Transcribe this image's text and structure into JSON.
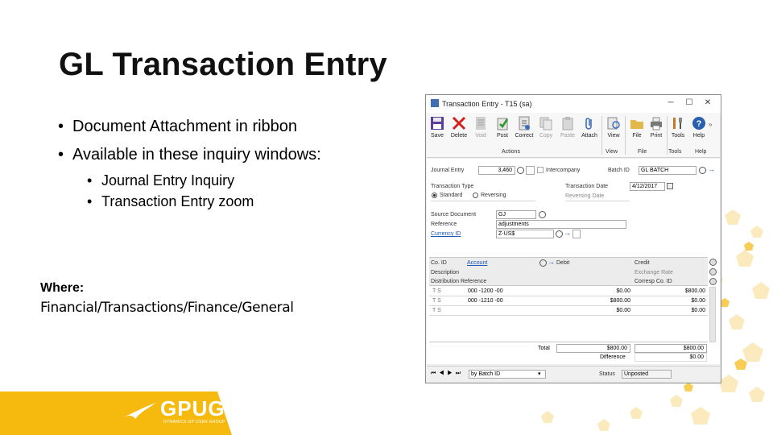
{
  "slide": {
    "title": "GL Transaction Entry",
    "bullets": [
      "Document Attachment in ribbon",
      "Available in these inquiry windows:"
    ],
    "sub_bullets": [
      "Journal Entry Inquiry",
      "Transaction Entry zoom"
    ],
    "where_label": "Where:",
    "where_path": "Financial/Transactions/Finance/General"
  },
  "logo": {
    "text": "GPUG",
    "tagline": "DYNAMICS GP USER GROUP",
    "color": "#f6b90e"
  },
  "window": {
    "title": "Transaction Entry - T15 (sa)",
    "ribbon": {
      "buttons": [
        {
          "label": "Save",
          "icon": "save-icon",
          "enabled": true
        },
        {
          "label": "Delete",
          "icon": "delete-icon",
          "enabled": true
        },
        {
          "label": "Void",
          "icon": "void-icon",
          "enabled": false
        },
        {
          "label": "Post",
          "icon": "post-icon",
          "enabled": true
        },
        {
          "label": "Correct",
          "icon": "correct-icon",
          "enabled": true
        },
        {
          "label": "Copy",
          "icon": "copy-icon",
          "enabled": false
        },
        {
          "label": "Paste",
          "icon": "paste-icon",
          "enabled": false
        },
        {
          "label": "Attach",
          "icon": "attach-icon",
          "enabled": true
        },
        {
          "label": "View",
          "icon": "view-icon",
          "enabled": true
        },
        {
          "label": "File",
          "icon": "file-icon",
          "enabled": true
        },
        {
          "label": "Print",
          "icon": "print-icon",
          "enabled": true
        },
        {
          "label": "Tools",
          "icon": "tools-icon",
          "enabled": true
        },
        {
          "label": "Help",
          "icon": "help-icon",
          "enabled": true
        }
      ],
      "groups": [
        "Actions",
        "View",
        "File",
        "Tools",
        "Help"
      ]
    },
    "form": {
      "journal_entry_label": "Journal Entry",
      "journal_entry_value": "3,460",
      "intercompany_label": "Intercompany",
      "batch_id_label": "Batch ID",
      "batch_id_value": "GL BATCH",
      "transaction_type_label": "Transaction Type",
      "standard_label": "Standard",
      "reversing_label": "Reversing",
      "transaction_date_label": "Transaction Date",
      "transaction_date_value": "4/12/2017",
      "reversing_date_label": "Reversing Date",
      "source_document_label": "Source Document",
      "source_document_value": "GJ",
      "reference_label": "Reference",
      "reference_value": "adjustments",
      "currency_id_label": "Currency ID",
      "currency_id_value": "Z-US$"
    },
    "grid": {
      "headers": {
        "co_id": "Co. ID",
        "account": "Account",
        "debit": "Debit",
        "credit": "Credit",
        "description": "Description",
        "exchange_rate": "Exchange Rate",
        "distribution_reference": "Distribution Reference",
        "corresp_co_id": "Corresp Co. ID"
      },
      "rows": [
        {
          "co": "T S",
          "account": "000 -1200 -00",
          "debit": "$0.00",
          "credit": "$800.00"
        },
        {
          "co": "T S",
          "account": "000 -1210 -00",
          "debit": "$800.00",
          "credit": "$0.00"
        },
        {
          "co": "T S",
          "account": "",
          "debit": "$0.00",
          "credit": "$0.00"
        }
      ],
      "total_label": "Total",
      "total_debit": "$800.00",
      "total_credit": "$800.00",
      "difference_label": "Difference",
      "difference_value": "$0.00"
    },
    "status": {
      "sort_value": "by Batch ID",
      "status_label": "Status",
      "status_value": "Unposted"
    }
  }
}
